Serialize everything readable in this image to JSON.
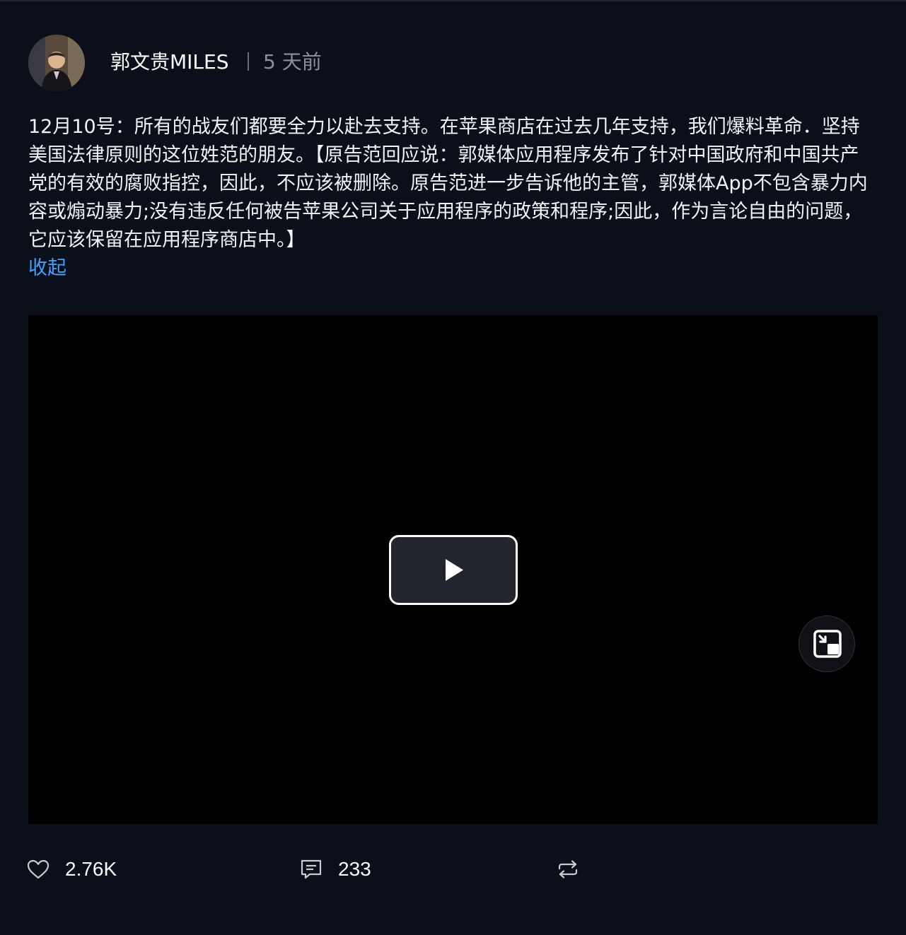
{
  "post": {
    "author": "郭文贵MILES",
    "time": "5 天前",
    "body": "12月10号：所有的战友们都要全力以赴去支持。在苹果商店在过去几年支持，我们爆料革命．坚持美国法律原则的这位姓范的朋友。【原告范回应说：郭媒体应用程序发布了针对中国政府和中国共产党的有效的腐败指控，因此，不应该被删除。原告范进一步告诉他的主管，郭媒体App不包含暴力内容或煽动暴力;没有违反任何被告苹果公司关于应用程序的政策和程序;因此，作为言论自由的问题，它应该保留在应用程序商店中。】",
    "collapse_label": "收起"
  },
  "video": {
    "play_icon": "play-icon",
    "pip_icon": "picture-in-picture-icon"
  },
  "actions": {
    "like_count": "2.76K",
    "comment_count": "233",
    "like_icon": "heart-icon",
    "comment_icon": "comment-icon",
    "repost_icon": "repost-icon"
  },
  "colors": {
    "background": "#0b0f19",
    "link": "#3ea1ff",
    "muted": "#8a8f99"
  }
}
